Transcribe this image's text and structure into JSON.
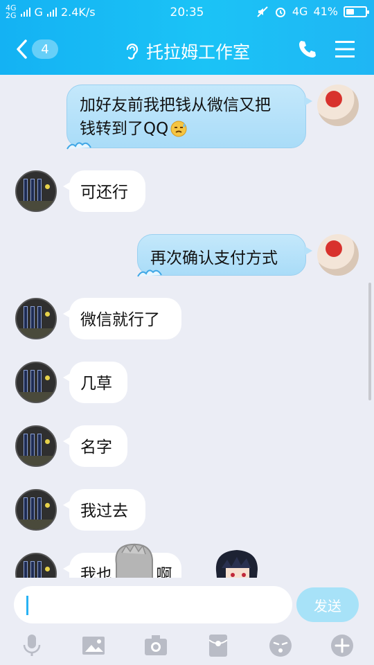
{
  "status_bar": {
    "network_left_top": "4G",
    "network_left_bottom": "2G",
    "network_g": "G",
    "speed": "2.4K/s",
    "time": "20:35",
    "network_right": "4G",
    "battery_percent_text": "41%",
    "battery_level": 0.41
  },
  "header": {
    "back_count": "4",
    "title": "托拉姆工作室",
    "icons": {
      "back": "chevron-left",
      "ear": "ear-icon",
      "phone": "phone-icon",
      "menu": "menu-icon"
    }
  },
  "messages": [
    {
      "side": "out",
      "text_line1": "加好友前我把钱从微信又把",
      "text_line2": "钱转到了QQ",
      "emoji": "sweat-emoji"
    },
    {
      "side": "in",
      "text": "可还行"
    },
    {
      "side": "out",
      "text": "再次确认支付方式"
    },
    {
      "side": "in",
      "text": "微信就行了"
    },
    {
      "side": "in",
      "text": "几草"
    },
    {
      "side": "in",
      "text": "名字"
    },
    {
      "side": "in",
      "text": "我过去"
    },
    {
      "side": "in",
      "text": "我也",
      "text_tail": "啊"
    }
  ],
  "composer": {
    "input_value": "",
    "send_label": "发送"
  },
  "toolbar": [
    "mic-icon",
    "image-icon",
    "camera-icon",
    "red-packet-icon",
    "emoji-icon",
    "plus-icon"
  ],
  "colors": {
    "header": "#1bbaf5",
    "bubble_out": "#b3e0f9",
    "send_disabled": "#a7e2f8",
    "background": "#ebedf5"
  }
}
